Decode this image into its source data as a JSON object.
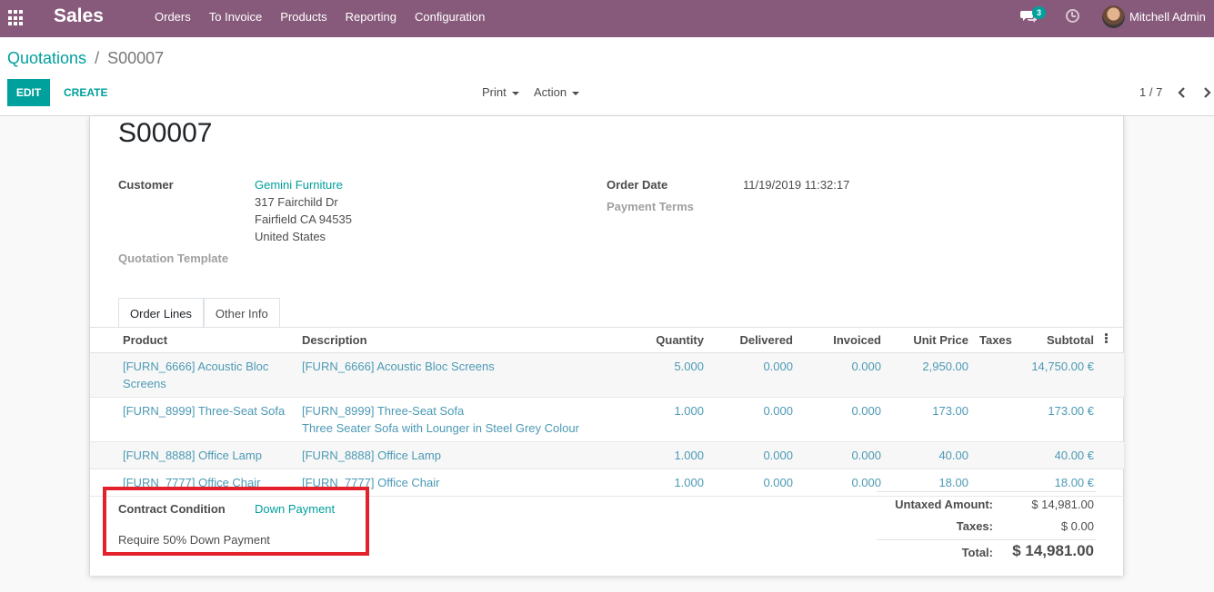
{
  "navbar": {
    "app_name": "Sales",
    "menu": [
      "Orders",
      "To Invoice",
      "Products",
      "Reporting",
      "Configuration"
    ],
    "chat_count": "3",
    "user_name": "Mitchell Admin",
    "bg_color": "#875a7b"
  },
  "breadcrumb": {
    "parent": "Quotations",
    "separator": "/",
    "current": "S00007"
  },
  "toolbar": {
    "edit": "EDIT",
    "create": "CREATE",
    "print": "Print",
    "action": "Action",
    "pager": "1 / 7"
  },
  "order": {
    "name": "S00007",
    "customer_label": "Customer",
    "customer_name": "Gemini Furniture",
    "customer_street": "317 Fairchild Dr",
    "customer_city": "Fairfield CA 94535",
    "customer_country": "United States",
    "quotation_template_label": "Quotation Template",
    "order_date_label": "Order Date",
    "order_date": "11/19/2019 11:32:17",
    "payment_terms_label": "Payment Terms"
  },
  "tabs": [
    "Order Lines",
    "Other Info"
  ],
  "lines": {
    "headers": [
      "Product",
      "Description",
      "Quantity",
      "Delivered",
      "Invoiced",
      "Unit Price",
      "Taxes",
      "Subtotal"
    ],
    "rows": [
      {
        "product": "[FURN_6666] Acoustic Bloc Screens",
        "desc": "[FURN_6666] Acoustic Bloc Screens",
        "desc2": "",
        "qty": "5.000",
        "delivered": "0.000",
        "invoiced": "0.000",
        "price": "2,950.00",
        "taxes": "",
        "subtotal": "14,750.00 €"
      },
      {
        "product": "[FURN_8999] Three-Seat Sofa",
        "desc": "[FURN_8999] Three-Seat Sofa",
        "desc2": "Three Seater Sofa with Lounger in Steel Grey Colour",
        "qty": "1.000",
        "delivered": "0.000",
        "invoiced": "0.000",
        "price": "173.00",
        "taxes": "",
        "subtotal": "173.00 €"
      },
      {
        "product": "[FURN_8888] Office Lamp",
        "desc": "[FURN_8888] Office Lamp",
        "desc2": "",
        "qty": "1.000",
        "delivered": "0.000",
        "invoiced": "0.000",
        "price": "40.00",
        "taxes": "",
        "subtotal": "40.00 €"
      },
      {
        "product": "[FURN_7777] Office Chair",
        "desc": "[FURN_7777] Office Chair",
        "desc2": "",
        "qty": "1.000",
        "delivered": "0.000",
        "invoiced": "0.000",
        "price": "18.00",
        "taxes": "",
        "subtotal": "18.00 €"
      }
    ]
  },
  "contract": {
    "label": "Contract Condition",
    "value": "Down Payment",
    "note": "Require 50% Down Payment",
    "highlight_color": "#e3212d"
  },
  "totals": {
    "untaxed_label": "Untaxed Amount:",
    "untaxed": "$ 14,981.00",
    "taxes_label": "Taxes:",
    "taxes": "$ 0.00",
    "total_label": "Total:",
    "total": "$ 14,981.00"
  }
}
